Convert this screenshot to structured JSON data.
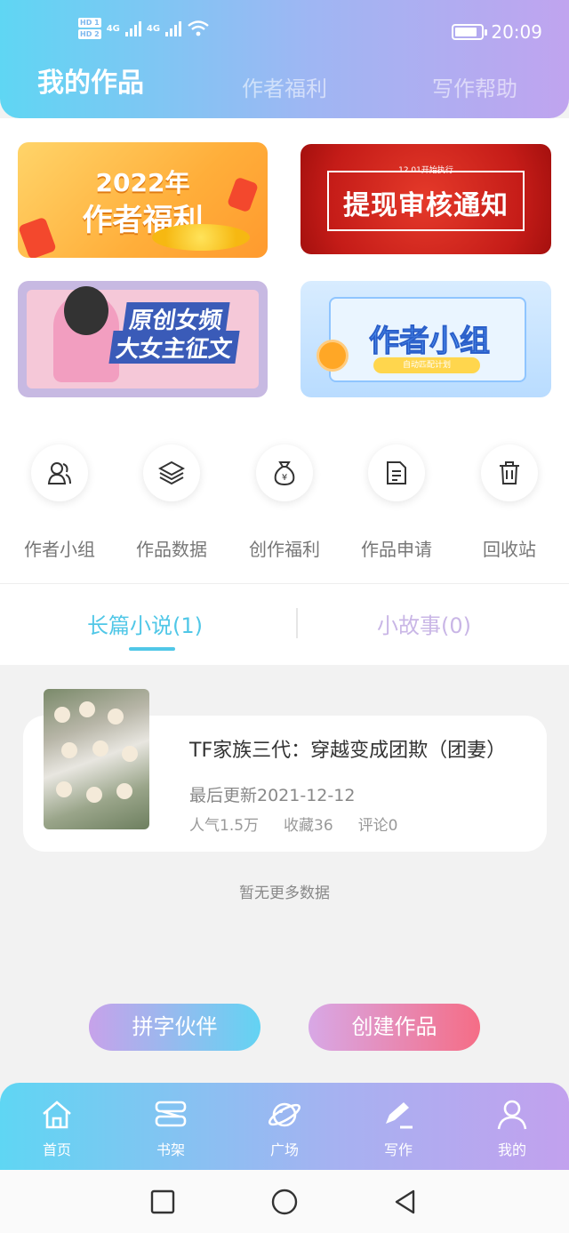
{
  "status_bar": {
    "time": "20:09",
    "hd1": "HD 1",
    "hd2": "HD 2",
    "net1": "4G",
    "net2": "4G"
  },
  "top_tabs": [
    {
      "label": "我的作品",
      "active": true
    },
    {
      "label": "作者福利",
      "active": false
    },
    {
      "label": "写作帮助",
      "active": false
    }
  ],
  "banners": {
    "welfare": {
      "year": "2022年",
      "title": "作者福利"
    },
    "withdraw": {
      "small": "12.01开始执行",
      "title": "提现审核通知"
    },
    "contest": {
      "line1": "原创女频",
      "line2": "大女主征文"
    },
    "group": {
      "title": "作者小组",
      "tag": "自动匹配计划"
    }
  },
  "quick_actions": [
    {
      "label": "作者小组",
      "icon": "people-icon"
    },
    {
      "label": "作品数据",
      "icon": "layers-icon"
    },
    {
      "label": "创作福利",
      "icon": "money-bag-icon"
    },
    {
      "label": "作品申请",
      "icon": "document-icon"
    },
    {
      "label": "回收站",
      "icon": "trash-icon"
    }
  ],
  "segments": [
    {
      "label": "长篇小说(1)",
      "active": true
    },
    {
      "label": "小故事(0)",
      "active": false
    }
  ],
  "work": {
    "title": "TF家族三代：穿越变成团欺（团妻）",
    "updated": "最后更新2021-12-12",
    "popularity": "人气1.5万",
    "favorites": "收藏36",
    "comments": "评论0"
  },
  "no_more": "暂无更多数据",
  "buttons": {
    "partner": "拼字伙伴",
    "create": "创建作品"
  },
  "bottom_nav": [
    {
      "label": "首页",
      "icon": "home-icon"
    },
    {
      "label": "书架",
      "icon": "bookshelf-icon"
    },
    {
      "label": "广场",
      "icon": "planet-icon"
    },
    {
      "label": "写作",
      "icon": "pen-icon"
    },
    {
      "label": "我的",
      "icon": "user-icon"
    }
  ],
  "colors": {
    "accent": "#50c7e7",
    "accent_secondary": "#c9b6e6",
    "create_pink": "#f56d86"
  }
}
